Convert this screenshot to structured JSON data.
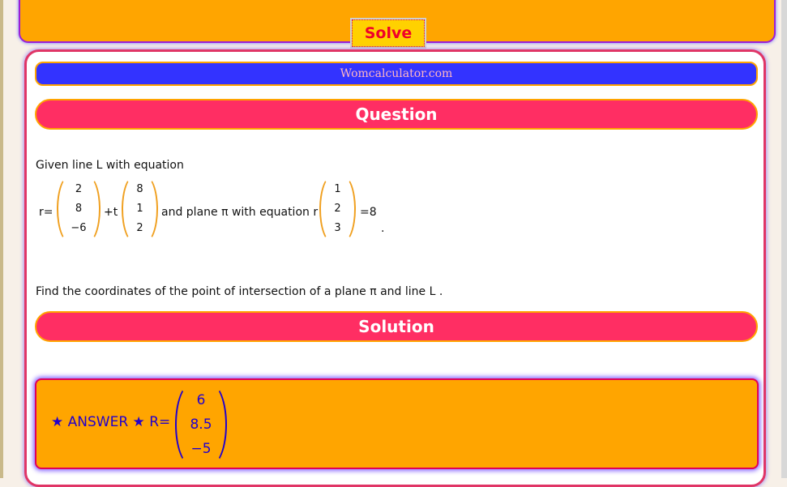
{
  "toolbar": {
    "solve_label": "Solve"
  },
  "site": {
    "name": "Womcalculator.com"
  },
  "sections": {
    "question_title": "Question",
    "solution_title": "Solution"
  },
  "question": {
    "intro": "Given line L with equation",
    "r_prefix": "r=",
    "vector_a": [
      "2",
      "8",
      "−6"
    ],
    "plus_t": "+t",
    "vector_b": [
      "8",
      "1",
      "2"
    ],
    "plane_text": "and plane π with equation r",
    "vector_n": [
      "1",
      "2",
      "3"
    ],
    "equals_text": "=8",
    "dot": ".",
    "task": "Find the coordinates of the point of intersection of a plane π and line L ."
  },
  "answer": {
    "label": "★ ANSWER ★  R=",
    "vector": [
      "6",
      "8.5",
      "−5"
    ]
  },
  "colors": {
    "accent_orange": "#ffa500",
    "section_pink": "#ff2e63",
    "site_blue": "#3333ff",
    "answer_text": "#2200cc",
    "solve_red": "#f0002a",
    "solve_yellow": "#ffd100"
  }
}
